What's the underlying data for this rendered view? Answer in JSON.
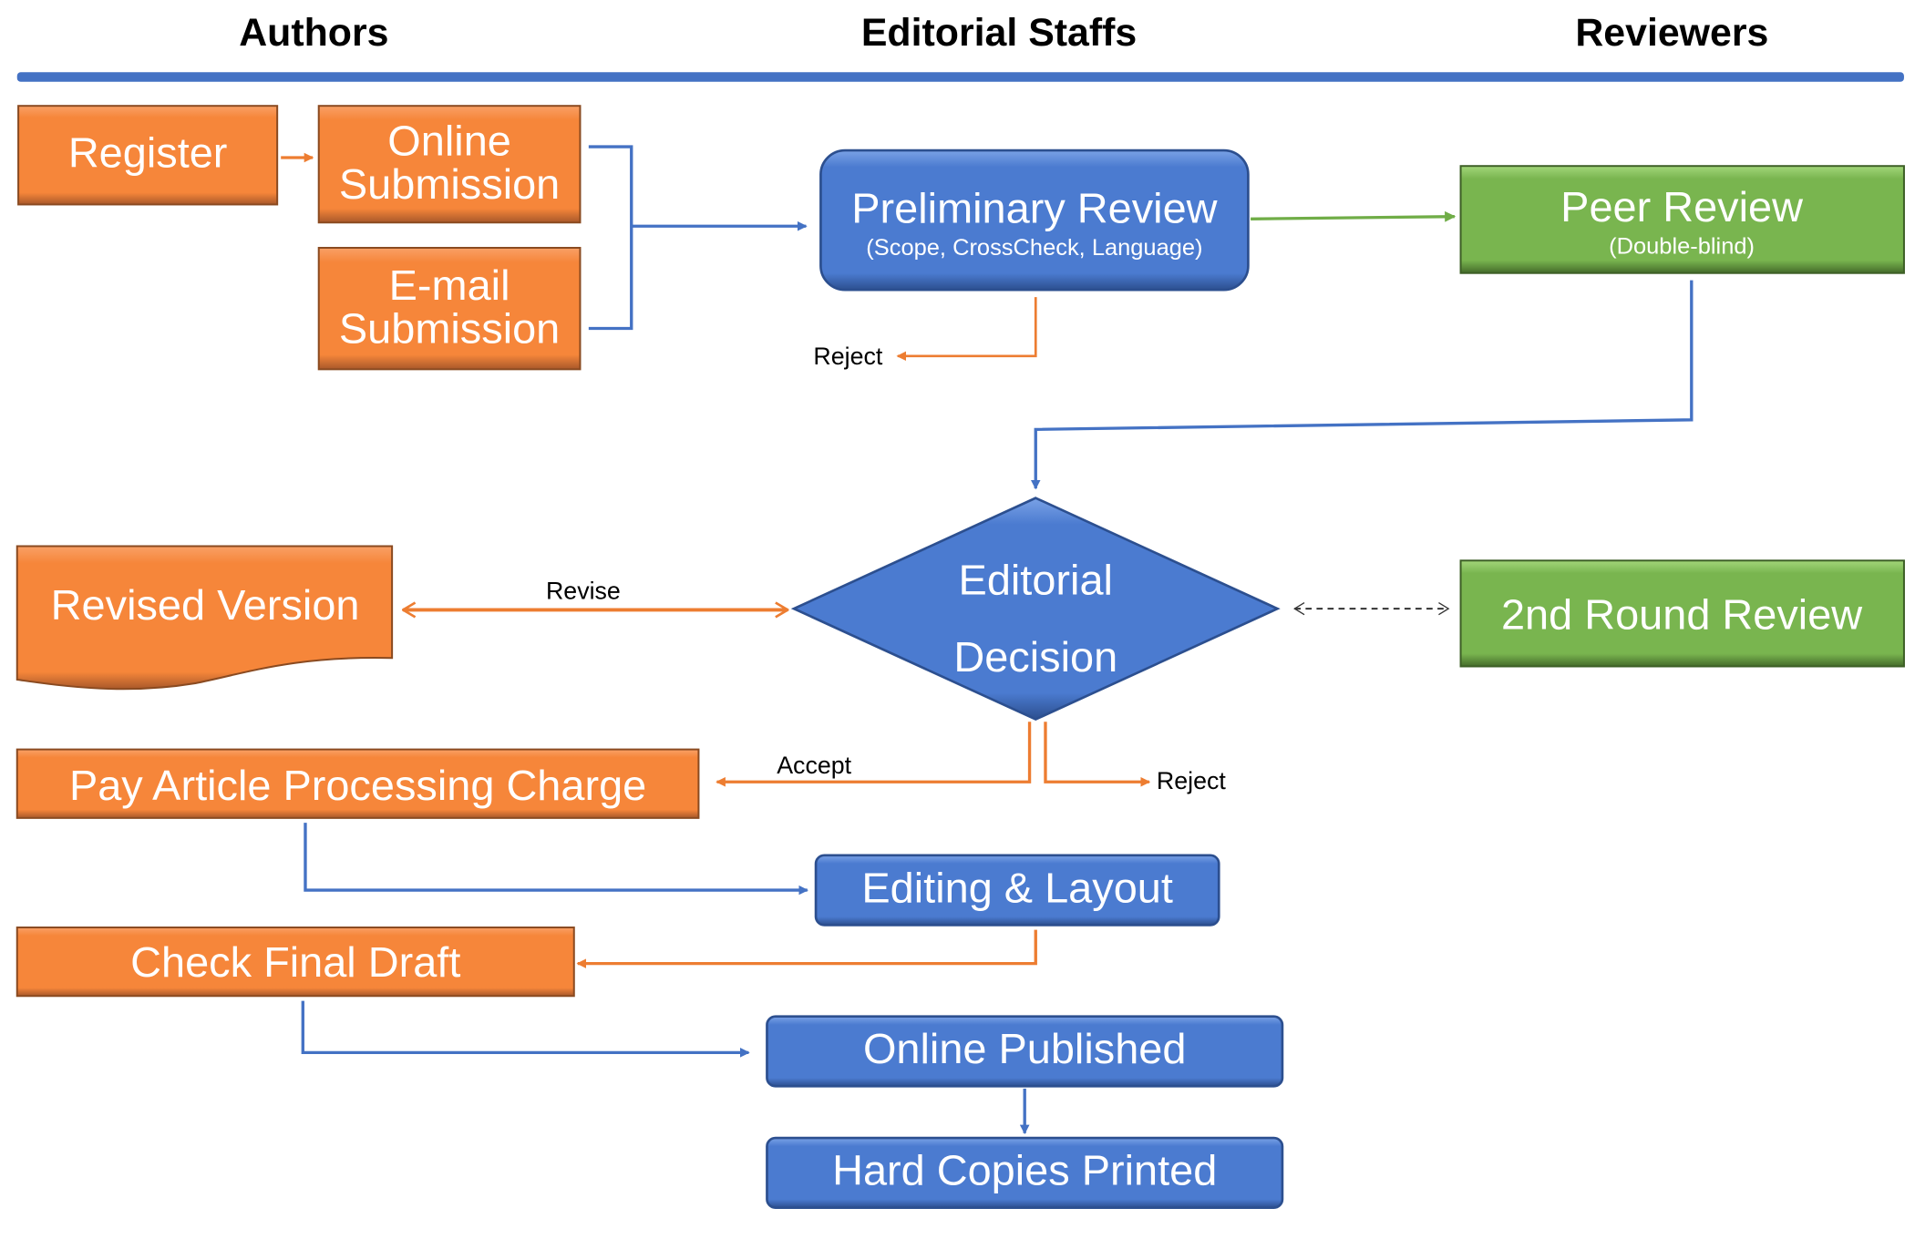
{
  "lanes": {
    "authors": "Authors",
    "editorial": "Editorial Staffs",
    "reviewers": "Reviewers"
  },
  "colors": {
    "orange": "#f6863a",
    "blue": "#4b7bd0",
    "green": "#79b54f",
    "orange_line": "#ed7d31",
    "blue_line": "#4472c4",
    "green_line": "#70ad47",
    "divider": "#4472c4"
  },
  "nodes": {
    "register": "Register",
    "online_submission": [
      "Online",
      "Submission"
    ],
    "email_submission": [
      "E-mail",
      "Submission"
    ],
    "preliminary_review": {
      "title": "Preliminary Review",
      "subtitle": "(Scope, CrossCheck, Language)"
    },
    "peer_review": {
      "title": "Peer Review",
      "subtitle": "(Double-blind)"
    },
    "editorial_decision": [
      "Editorial",
      "Decision"
    ],
    "revised_version": "Revised Version",
    "second_round_review": "2nd Round Review",
    "pay_apc": "Pay Article Processing Charge",
    "editing_layout": "Editing & Layout",
    "check_final_draft": "Check Final Draft",
    "online_published": "Online Published",
    "hard_copies_printed": "Hard Copies Printed"
  },
  "edge_labels": {
    "reject_preliminary": "Reject",
    "revise": "Revise",
    "accept": "Accept",
    "reject_decision": "Reject"
  }
}
